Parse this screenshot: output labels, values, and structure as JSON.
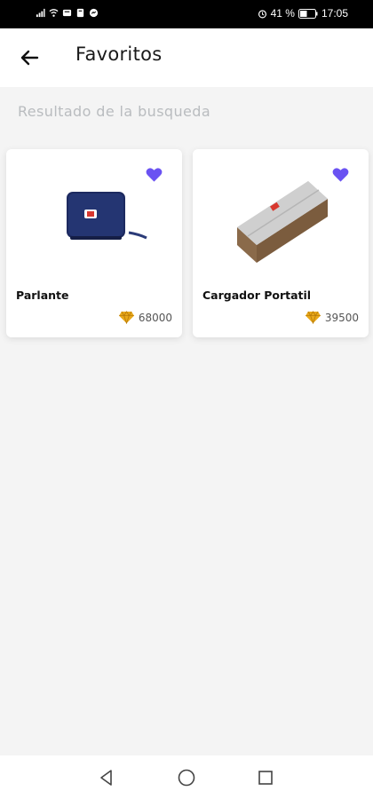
{
  "status_bar": {
    "battery_percent": "41 %",
    "time": "17:05"
  },
  "header": {
    "title": "Favoritos",
    "back_icon": "arrow-left-icon"
  },
  "results_label": "Resultado de la busqueda",
  "products": [
    {
      "name": "Parlante",
      "price": "68000",
      "favorite": true
    },
    {
      "name": "Cargador Portatil",
      "price": "39500",
      "favorite": true
    }
  ],
  "colors": {
    "accent_heart": "#6a52f2",
    "gem_gold": "#e8a81a",
    "background": "#f4f4f4"
  },
  "nav_bar": {
    "icons": [
      "back-triangle-icon",
      "home-circle-icon",
      "recents-square-icon"
    ]
  }
}
